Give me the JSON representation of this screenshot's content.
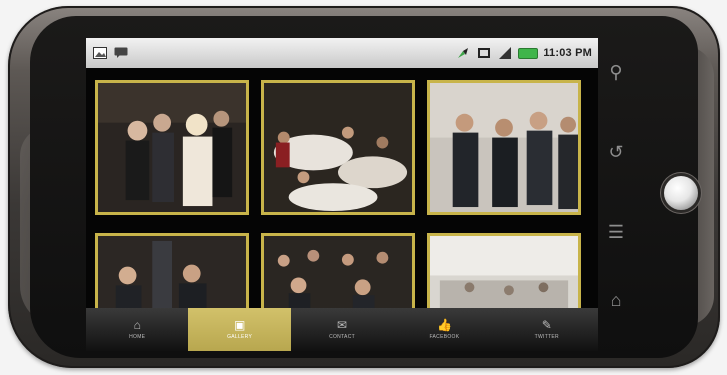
{
  "status_bar": {
    "time": "11:03 PM",
    "left_icons": [
      "image-icon",
      "chat-icon"
    ],
    "right_icons": [
      "signal-icon",
      "sim-icon",
      "network-icon",
      "battery-icon"
    ],
    "battery_color": "#3fb54a"
  },
  "gallery": {
    "thumbnails": [
      {
        "scene": "photo-icon"
      },
      {
        "scene": "photo-icon"
      },
      {
        "scene": "photo-icon"
      },
      {
        "scene": "photo-icon"
      },
      {
        "scene": "photo-icon"
      },
      {
        "scene": "photo-icon"
      }
    ],
    "frame_color": "#c8b44a"
  },
  "tabs": [
    {
      "label": "HOME",
      "icon": "home-icon",
      "active": false
    },
    {
      "label": "GALLERY",
      "icon": "gallery-icon",
      "active": true
    },
    {
      "label": "CONTACT",
      "icon": "contact-icon",
      "active": false
    },
    {
      "label": "FACEBOOK",
      "icon": "facebook-icon",
      "active": false
    },
    {
      "label": "TWITTER",
      "icon": "twitter-icon",
      "active": false
    }
  ],
  "accent_color": "#c8b44a"
}
